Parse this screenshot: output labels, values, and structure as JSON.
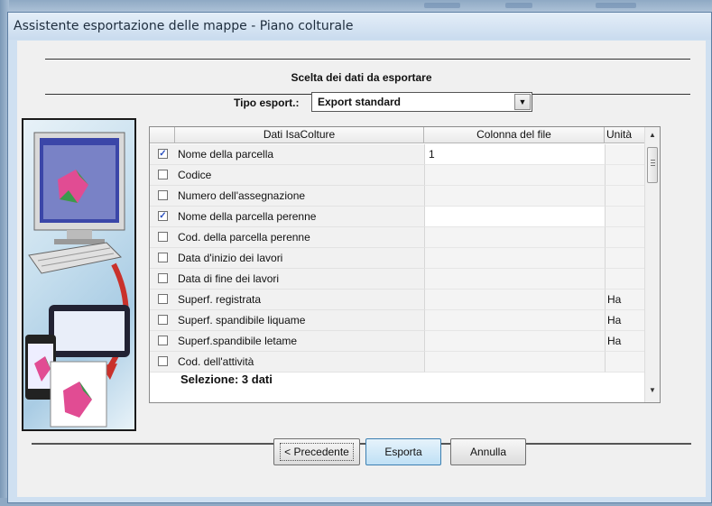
{
  "window": {
    "title": "Assistente esportazione delle mappe - Piano colturale"
  },
  "header": {
    "title": "Scelta dei dati da esportare"
  },
  "export_type": {
    "label": "Tipo esport.:",
    "value": "Export standard"
  },
  "grid": {
    "columns": [
      "Dati IsaColture",
      "Colonna del file",
      "Unità"
    ],
    "rows": [
      {
        "checked": true,
        "name": "Nome della parcella",
        "column": "1",
        "unit": ""
      },
      {
        "checked": false,
        "name": "Codice",
        "column": "",
        "unit": ""
      },
      {
        "checked": false,
        "name": "Numero dell'assegnazione",
        "column": "",
        "unit": ""
      },
      {
        "checked": true,
        "name": "Nome della parcella perenne",
        "column": "",
        "unit": ""
      },
      {
        "checked": false,
        "name": "Cod. della parcella perenne",
        "column": "",
        "unit": ""
      },
      {
        "checked": false,
        "name": "Data d'inizio dei lavori",
        "column": "",
        "unit": ""
      },
      {
        "checked": false,
        "name": "Data di fine dei lavori",
        "column": "",
        "unit": ""
      },
      {
        "checked": false,
        "name": "Superf. registrata",
        "column": "",
        "unit": "Ha"
      },
      {
        "checked": false,
        "name": "Superf. spandibile liquame",
        "column": "",
        "unit": "Ha"
      },
      {
        "checked": false,
        "name": "Superf.spandibile letame",
        "column": "",
        "unit": "Ha"
      },
      {
        "checked": false,
        "name": "Cod. dell'attività",
        "column": "",
        "unit": ""
      }
    ],
    "selection": "Selezione: 3  dati"
  },
  "buttons": {
    "previous": "< Precedente",
    "export": "Esporta",
    "cancel": "Annulla"
  },
  "colors": {
    "title_bg": "#cfe0f1",
    "check": "#2a4fbf",
    "primary_button": "#bfe0f5"
  },
  "icons": [
    "computer-illustration",
    "dropdown-arrow-icon",
    "scroll-up-icon",
    "scroll-down-icon",
    "checkbox-checked-icon"
  ]
}
